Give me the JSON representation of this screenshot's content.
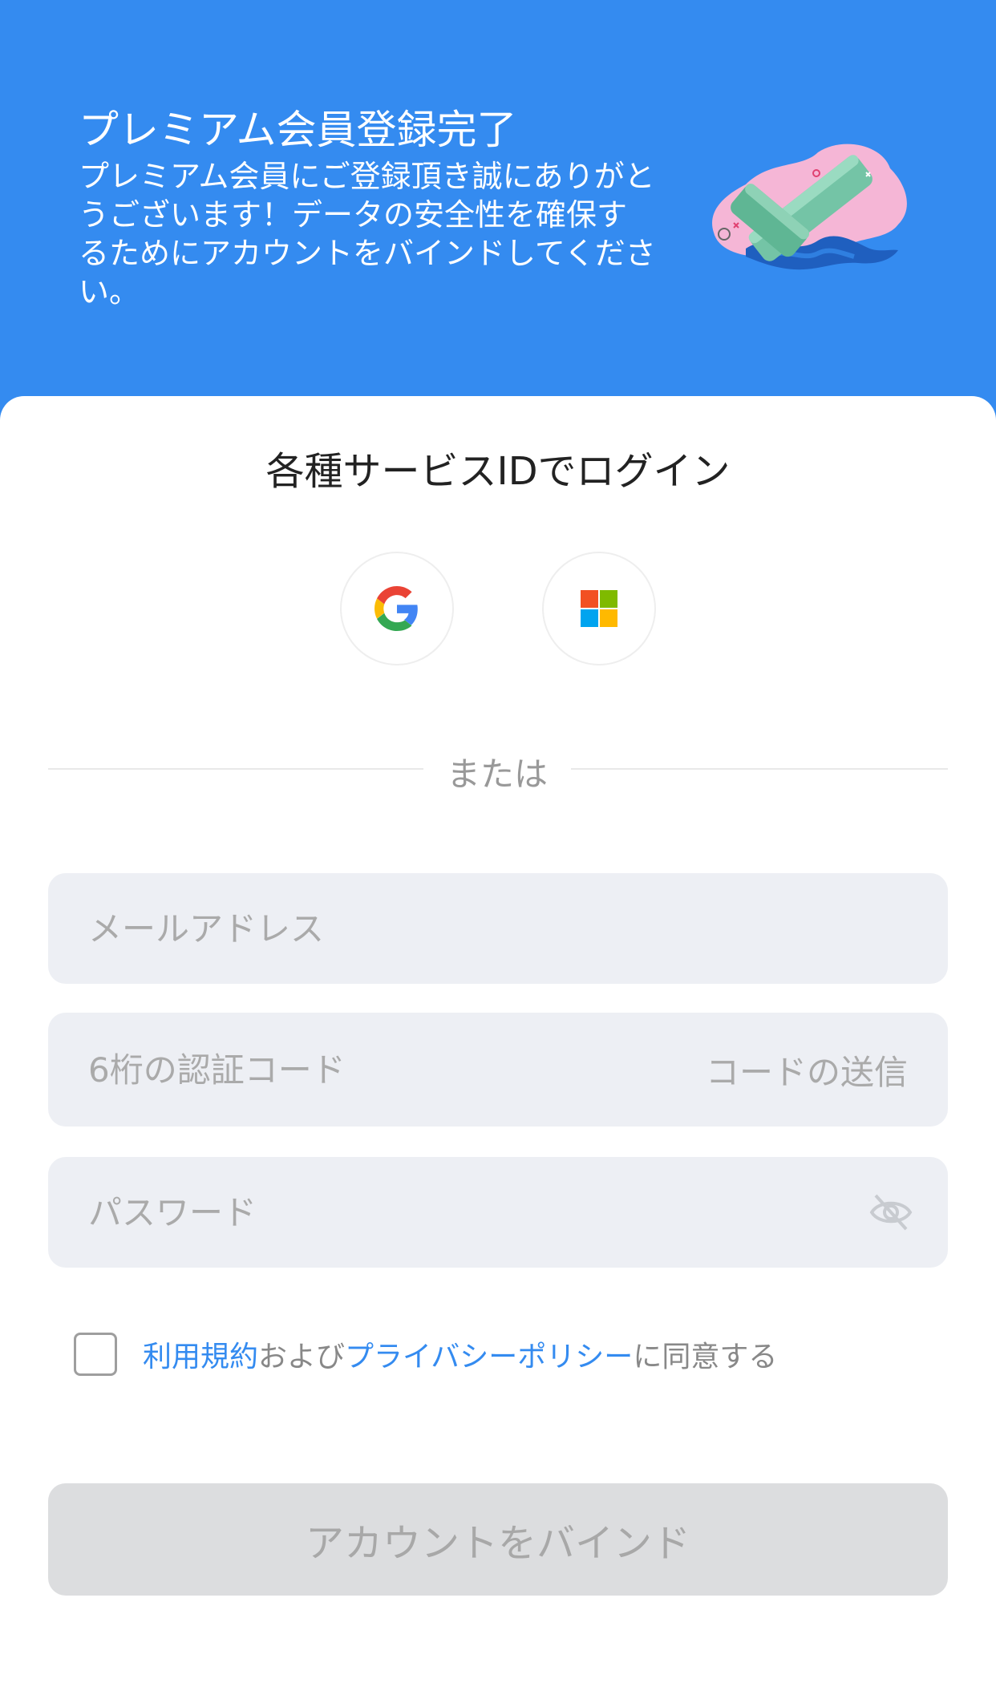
{
  "header": {
    "title": "プレミアム会員登録完了",
    "message": "プレミアム会員にご登録頂き誠にありがとうございます！データの安全性を確保するためにアカウントをバインドしてください。"
  },
  "login": {
    "title": "各種サービスIDでログイン",
    "providers": [
      "google-icon",
      "microsoft-icon"
    ]
  },
  "divider": {
    "text": "または"
  },
  "form": {
    "email_placeholder": "メールアドレス",
    "code_placeholder": "6桁の認証コード",
    "send_code_label": "コードの送信",
    "password_placeholder": "パスワード"
  },
  "agreement": {
    "terms_link": "利用規約",
    "and_text": " および",
    "privacy_link": "プライバシーポリシー",
    "suffix_text": "に同意する"
  },
  "bind_button": {
    "label": "アカウントをバインド"
  },
  "colors": {
    "header_bg": "#348BF0",
    "link": "#348BF0",
    "field_bg": "#EDEFF4",
    "button_disabled_bg": "#DCDDDF"
  }
}
